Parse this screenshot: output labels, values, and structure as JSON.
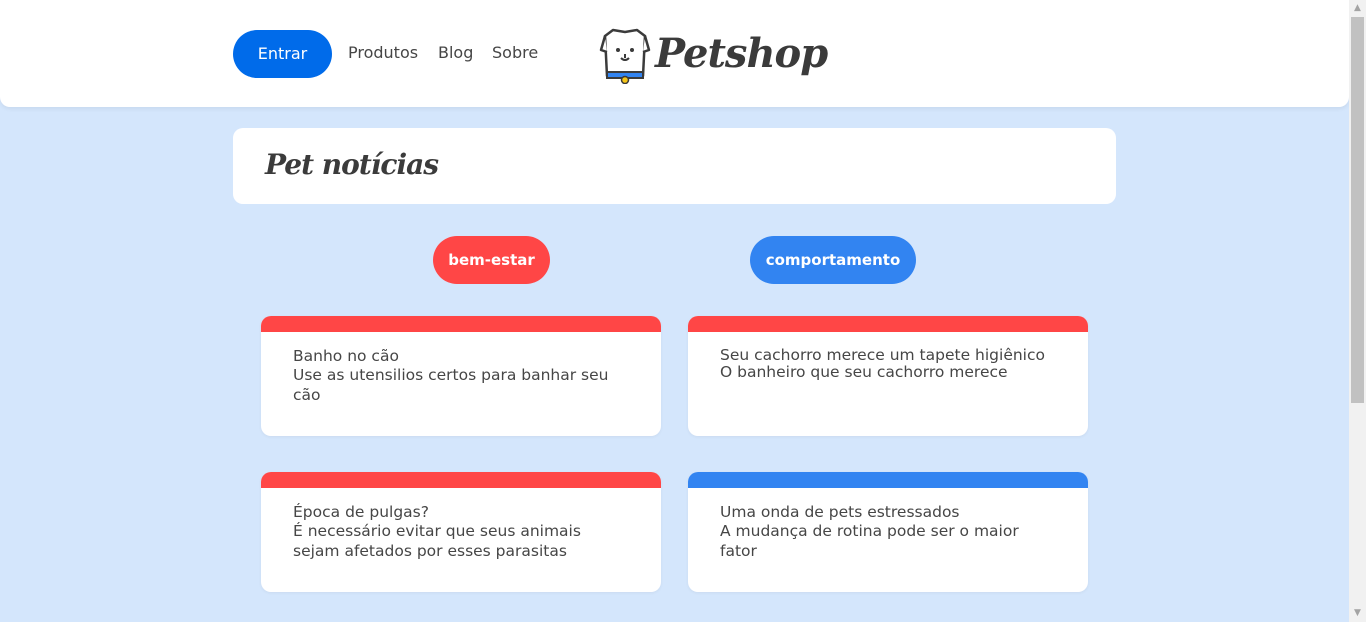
{
  "header": {
    "login_label": "Entrar",
    "nav": [
      "Produtos",
      "Blog",
      "Sobre"
    ],
    "logo_text": "Petshop"
  },
  "page": {
    "title": "Pet notícias"
  },
  "tags": [
    {
      "label": "bem-estar",
      "color": "#ff4646"
    },
    {
      "label": "comportamento",
      "color": "#3284f1"
    }
  ],
  "posts": [
    {
      "title": "Banho no cão",
      "subtitle": "Use as utensilios certos para banhar seu cão",
      "color": "#ff4646"
    },
    {
      "title": "Seu cachorro merece um tapete higiênico",
      "subtitle": "O banheiro que seu cachorro merece",
      "color": "#ff4646"
    },
    {
      "title": "Época de pulgas?",
      "subtitle": "É necessário evitar que seus animais sejam afetados por esses parasitas",
      "color": "#ff4646"
    },
    {
      "title": "Uma onda de pets estressados",
      "subtitle": "A mudança de rotina pode ser o maior fator",
      "color": "#3284f1"
    }
  ],
  "colors": {
    "background": "#d4e6fc",
    "primary": "#006bea",
    "text": "#464646"
  }
}
